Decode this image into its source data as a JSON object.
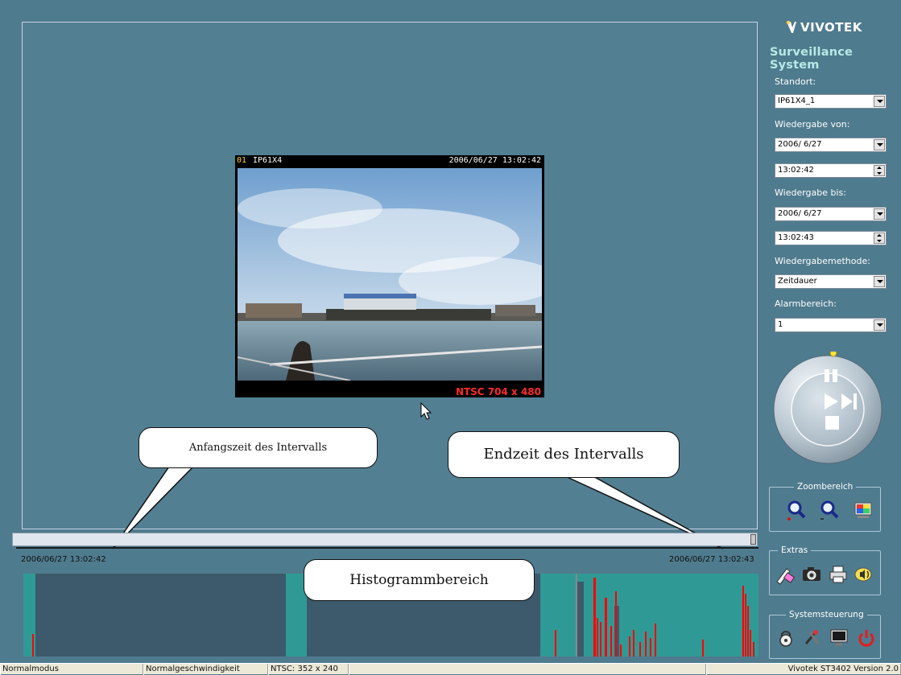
{
  "video": {
    "channel": "01",
    "camera_name": "IP61X4",
    "timestamp": "2006/06/27 13:02:42",
    "resolution": "NTSC 704 x 480"
  },
  "timeline": {
    "start_time": "2006/06/27 13:02:42",
    "end_time": "2006/06/27 13:02:43"
  },
  "callouts": {
    "start": "Anfangszeit des Intervalls",
    "end": "Endzeit des Intervalls",
    "histogram": "Histogrammbereich"
  },
  "brand": {
    "logo": "VIVOTEK",
    "subtitle": "Surveillance System"
  },
  "panel": {
    "standort_label": "Standort:",
    "standort_value": "IP61X4_1",
    "von_label": "Wiedergabe von:",
    "von_date": "2006/ 6/27",
    "von_time": "13:02:42",
    "bis_label": "Wiedergabe bis:",
    "bis_date": "2006/ 6/27",
    "bis_time": "13:02:43",
    "methode_label": "Wiedergabemethode:",
    "methode_value": "Zeitdauer",
    "alarm_label": "Alarmbereich:",
    "alarm_value": "1"
  },
  "groups": {
    "zoom": "Zoombereich",
    "extras": "Extras",
    "system": "Systemsteuerung"
  },
  "statusbar": {
    "mode": "Normalmodus",
    "speed": "Normalgeschwindigkeit",
    "format": "NTSC: 352 x 240",
    "version": "Vivotek ST3402   Version 2.0"
  },
  "colors": {
    "background": "#4f7b8e",
    "histogram_teal": "#2f9a95",
    "histogram_dark": "#3c5a6c",
    "histogram_alarm": "#ff0000"
  }
}
